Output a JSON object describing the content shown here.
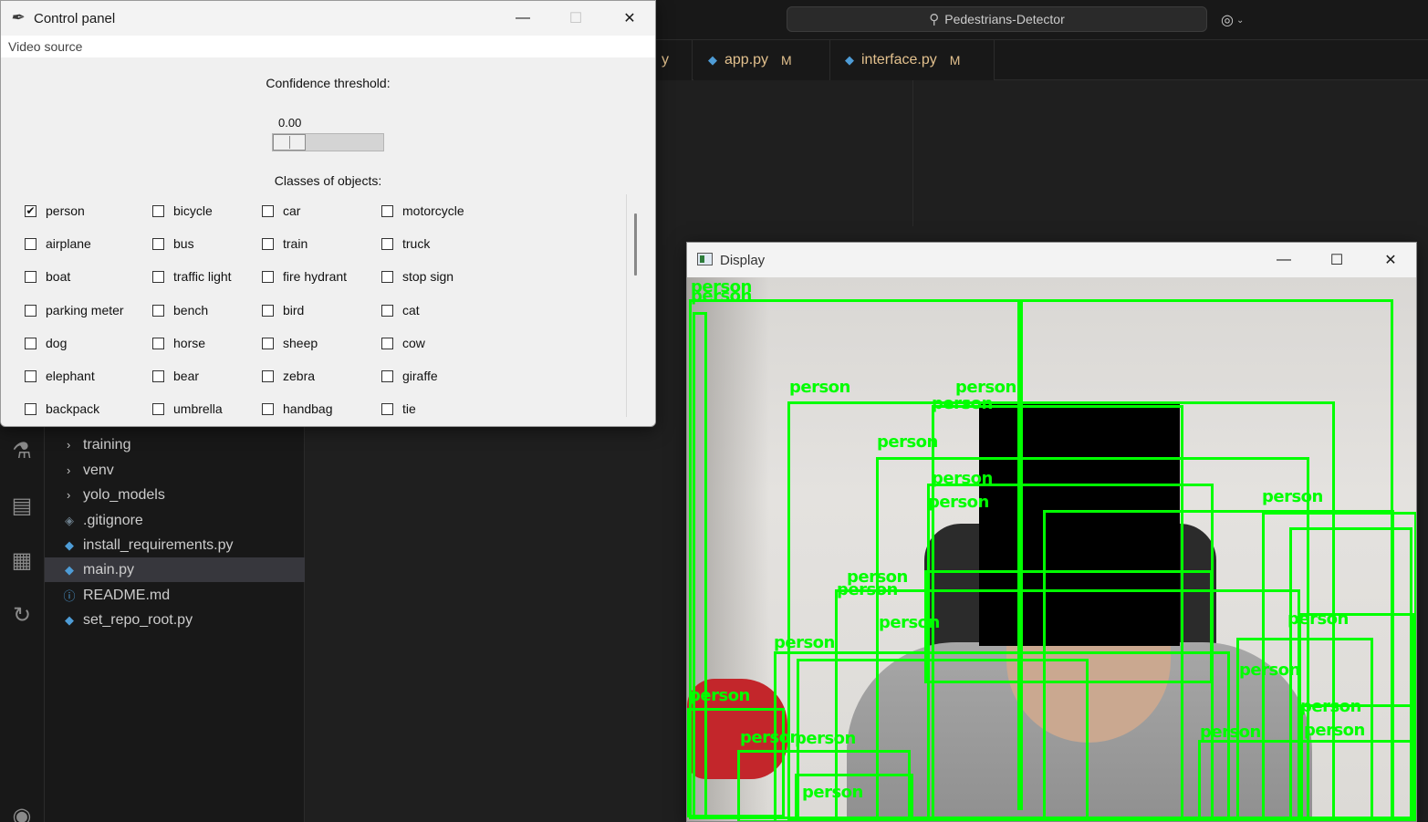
{
  "vscode": {
    "command_center": "Pedestrians-Detector",
    "tabs": [
      {
        "label": "app.py",
        "status": "M"
      },
      {
        "label": "interface.py",
        "status": "M"
      }
    ],
    "partial_tab_text": "y",
    "explorer_items": [
      {
        "label": "training",
        "type": "folder"
      },
      {
        "label": "venv",
        "type": "folder"
      },
      {
        "label": "yolo_models",
        "type": "folder"
      },
      {
        "label": ".gitignore",
        "type": "git"
      },
      {
        "label": "install_requirements.py",
        "type": "py"
      },
      {
        "label": "main.py",
        "type": "py",
        "selected": true
      },
      {
        "label": "README.md",
        "type": "info"
      },
      {
        "label": "set_repo_root.py",
        "type": "py"
      }
    ],
    "activity_icons": [
      "testing-icon",
      "remote-explorer-icon",
      "docker-icon",
      "source-control-remote-icon",
      "account-icon"
    ]
  },
  "control_panel": {
    "title": "Control panel",
    "menu": [
      "Video source"
    ],
    "confidence_label": "Confidence threshold:",
    "confidence_value": "0.00",
    "confidence_fraction": 0.0,
    "classes_label": "Classes of objects:",
    "classes": [
      [
        {
          "label": "person",
          "checked": true
        },
        {
          "label": "bicycle",
          "checked": false
        },
        {
          "label": "car",
          "checked": false
        },
        {
          "label": "motorcycle",
          "checked": false
        }
      ],
      [
        {
          "label": "airplane",
          "checked": false
        },
        {
          "label": "bus",
          "checked": false
        },
        {
          "label": "train",
          "checked": false
        },
        {
          "label": "truck",
          "checked": false
        }
      ],
      [
        {
          "label": "boat",
          "checked": false
        },
        {
          "label": "traffic light",
          "checked": false
        },
        {
          "label": "fire hydrant",
          "checked": false
        },
        {
          "label": "stop sign",
          "checked": false
        }
      ],
      [
        {
          "label": "parking meter",
          "checked": false
        },
        {
          "label": "bench",
          "checked": false
        },
        {
          "label": "bird",
          "checked": false
        },
        {
          "label": "cat",
          "checked": false
        }
      ],
      [
        {
          "label": "dog",
          "checked": false
        },
        {
          "label": "horse",
          "checked": false
        },
        {
          "label": "sheep",
          "checked": false
        },
        {
          "label": "cow",
          "checked": false
        }
      ],
      [
        {
          "label": "elephant",
          "checked": false
        },
        {
          "label": "bear",
          "checked": false
        },
        {
          "label": "zebra",
          "checked": false
        },
        {
          "label": "giraffe",
          "checked": false
        }
      ],
      [
        {
          "label": "backpack",
          "checked": false
        },
        {
          "label": "umbrella",
          "checked": false
        },
        {
          "label": "handbag",
          "checked": false
        },
        {
          "label": "tie",
          "checked": false
        }
      ]
    ]
  },
  "display": {
    "title": "Display",
    "detection_label": "person",
    "box_color": "#00ff00"
  }
}
